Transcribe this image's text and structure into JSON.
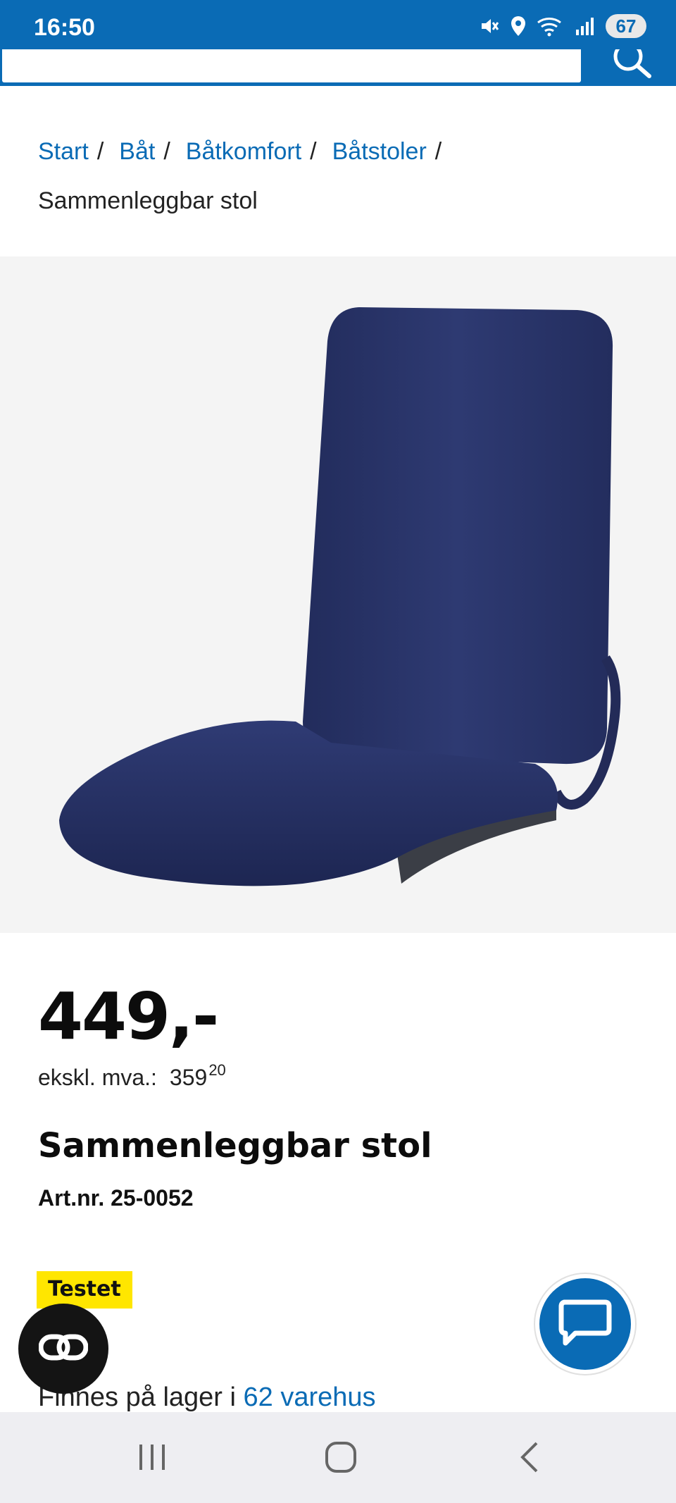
{
  "status_bar": {
    "time": "16:50",
    "battery": "67",
    "icons": [
      "mute-icon",
      "location-icon",
      "wifi-icon",
      "signal-icon"
    ]
  },
  "header": {
    "search_icon": "search-icon"
  },
  "breadcrumb": {
    "items": [
      "Start",
      "Båt",
      "Båtkomfort",
      "Båtstoler"
    ],
    "separator": "/",
    "current": "Sammenleggbar stol"
  },
  "product": {
    "price": "449,-",
    "ex_vat_label": "ekskl. mva.:",
    "ex_vat_whole": "359",
    "ex_vat_cents": "20",
    "title": "Sammenleggbar stol",
    "art_nr": "Art.nr. 25-0052",
    "badge": "Testet",
    "stock_prefix": "Finnes på lager i",
    "stock_link": "62 varehus"
  },
  "colors": {
    "brand_blue": "#0a6bb5",
    "badge_yellow": "#ffe600",
    "chair_navy": "#2a3568"
  },
  "floating": {
    "left_button_icon": "link-icon",
    "chat_button_icon": "chat-icon"
  },
  "nav": {
    "buttons": [
      "recents-icon",
      "home-icon",
      "back-icon"
    ]
  }
}
